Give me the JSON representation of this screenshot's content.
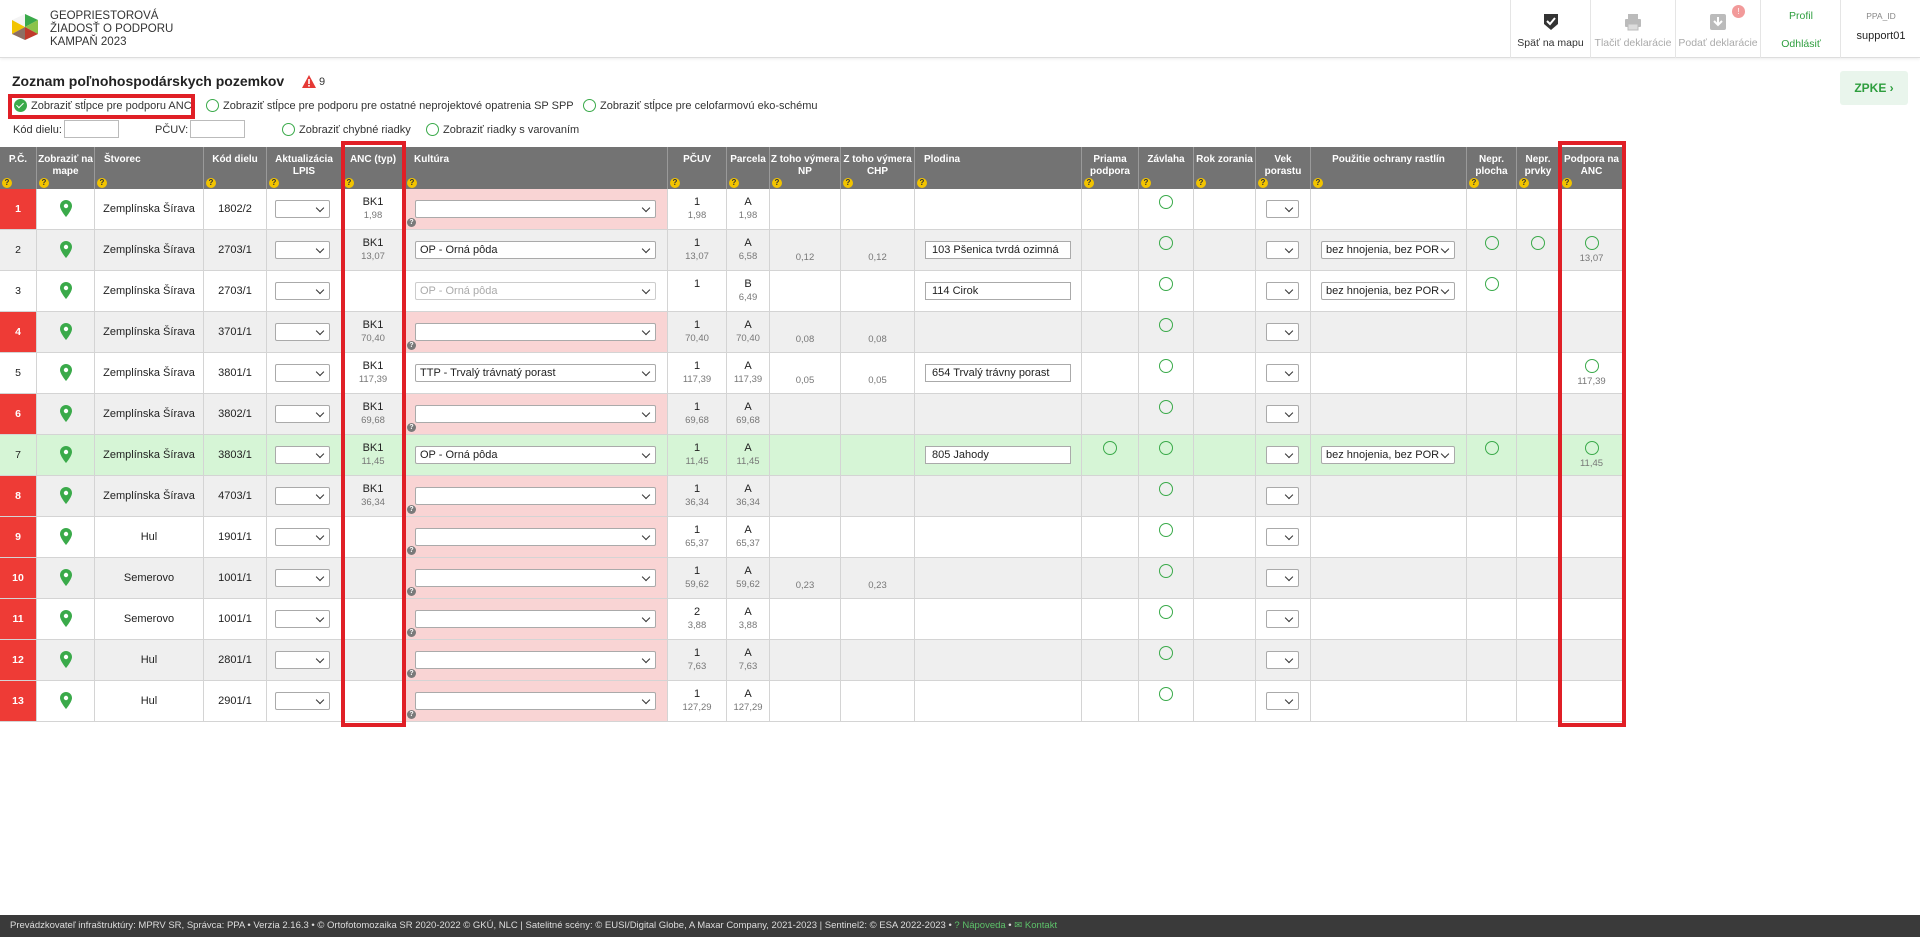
{
  "app": {
    "title_lines": [
      "GEOPRIESTOROVÁ",
      "ŽIADOSŤ O PODPORU",
      "KAMPAŇ 2023"
    ],
    "colors": {
      "accent": "#3aaa4a",
      "error": "#ee3b36",
      "highlight": "#e01f26",
      "header_bg": "#737373"
    }
  },
  "toolbar": {
    "back_to_map": "Späť na mapu",
    "print": "Tlačiť deklarácie",
    "submit": "Podať deklarácie",
    "submit_badge": "!",
    "profile": "Profil",
    "logout": "Odhlásiť",
    "ppa_id_label": "PPA_ID",
    "ppa_id_value": "support01"
  },
  "page": {
    "title": "Zoznam poľnohospodárskych pozemkov",
    "warning_count": "9",
    "zpke_label": "ZPKE"
  },
  "filters": {
    "anc": "Zobraziť stĺpce pre podporu ANC",
    "other": "Zobraziť stĺpce pre podporu pre ostatné neprojektové opatrenia SP SPP",
    "eco": "Zobraziť stĺpce pre celofarmovú eko-schému",
    "kod_dielu_label": "Kód dielu:",
    "pcuv_label": "PČUV:",
    "errors": "Zobraziť chybné riadky",
    "warnings": "Zobraziť riadky s varovaním"
  },
  "columns": {
    "pc": "P.Č.",
    "map": "Zobraziť na mape",
    "stvorec": "Štvorec",
    "kod": "Kód dielu",
    "lpis": "Aktualizácia LPIS",
    "anc": "ANC (typ)",
    "kultura": "Kultúra",
    "pcuv": "PČUV",
    "parcela": "Parcela",
    "np": "Z toho výmera NP",
    "chp": "Z toho výmera CHP",
    "plodina": "Plodina",
    "priama": "Priama podpora",
    "zavlaha": "Závlaha",
    "rok": "Rok zorania",
    "vek": "Vek porastu",
    "ochrana": "Použitie ochrany rastlín",
    "nepr_plocha": "Nepr. plocha",
    "nepr_prvky": "Nepr. prvky",
    "podpora_anc": "Podpora na ANC"
  },
  "rows": [
    {
      "pc": "1",
      "err": true,
      "stvorec": "Zemplínska Šírava",
      "kod": "1802/2",
      "anc": "BK1",
      "anc_area": "1,98",
      "kultura": "",
      "pcuv": "1",
      "pcuv_area": "1,98",
      "parcela": "A",
      "parcela_area": "1,98",
      "np": "",
      "chp": "",
      "plodina": "",
      "priama": false,
      "ochrana": "",
      "nepr_plocha": false,
      "nepr_prvky": false,
      "podpora": false,
      "podpora_area": ""
    },
    {
      "pc": "2",
      "err": false,
      "stvorec": "Zemplínska Šírava",
      "kod": "2703/1",
      "anc": "BK1",
      "anc_area": "13,07",
      "kultura": "OP - Orná pôda",
      "pcuv": "1",
      "pcuv_area": "13,07",
      "parcela": "A",
      "parcela_area": "6,58",
      "np": "0,12",
      "chp": "0,12",
      "plodina": "103  Pšenica tvrdá ozimná",
      "priama": false,
      "ochrana": "bez hnojenia, bez POR",
      "nepr_plocha": true,
      "nepr_prvky": true,
      "podpora": true,
      "podpora_area": "13,07"
    },
    {
      "pc": "3",
      "err": false,
      "stvorec": "Zemplínska Šírava",
      "kod": "2703/1",
      "anc": "",
      "anc_area": "",
      "kultura": "OP - Orná pôda",
      "kultura_disabled": true,
      "pcuv": "1",
      "pcuv_area": "",
      "parcela": "B",
      "parcela_area": "6,49",
      "np": "",
      "chp": "",
      "plodina": "114  Cirok",
      "priama": false,
      "ochrana": "bez hnojenia, bez POR",
      "nepr_plocha": true,
      "nepr_prvky": false,
      "podpora": false,
      "podpora_area": ""
    },
    {
      "pc": "4",
      "err": true,
      "stvorec": "Zemplínska Šírava",
      "kod": "3701/1",
      "anc": "BK1",
      "anc_area": "70,40",
      "kultura": "",
      "pcuv": "1",
      "pcuv_area": "70,40",
      "parcela": "A",
      "parcela_area": "70,40",
      "np": "0,08",
      "chp": "0,08",
      "plodina": "",
      "priama": false,
      "ochrana": "",
      "nepr_plocha": false,
      "nepr_prvky": false,
      "podpora": false,
      "podpora_area": ""
    },
    {
      "pc": "5",
      "err": false,
      "stvorec": "Zemplínska Šírava",
      "kod": "3801/1",
      "anc": "BK1",
      "anc_area": "117,39",
      "kultura": "TTP - Trvalý trávnatý porast",
      "pcuv": "1",
      "pcuv_area": "117,39",
      "parcela": "A",
      "parcela_area": "117,39",
      "np": "0,05",
      "chp": "0,05",
      "plodina": "654  Trvalý trávny porast",
      "priama": false,
      "ochrana": "",
      "nepr_plocha": false,
      "nepr_prvky": false,
      "podpora": true,
      "podpora_area": "117,39"
    },
    {
      "pc": "6",
      "err": true,
      "stvorec": "Zemplínska Šírava",
      "kod": "3802/1",
      "anc": "BK1",
      "anc_area": "69,68",
      "kultura": "",
      "pcuv": "1",
      "pcuv_area": "69,68",
      "parcela": "A",
      "parcela_area": "69,68",
      "np": "",
      "chp": "",
      "plodina": "",
      "priama": false,
      "ochrana": "",
      "nepr_plocha": false,
      "nepr_prvky": false,
      "podpora": false,
      "podpora_area": ""
    },
    {
      "pc": "7",
      "err": false,
      "green": true,
      "stvorec": "Zemplínska Šírava",
      "kod": "3803/1",
      "anc": "BK1",
      "anc_area": "11,45",
      "kultura": "OP - Orná pôda",
      "pcuv": "1",
      "pcuv_area": "11,45",
      "parcela": "A",
      "parcela_area": "11,45",
      "np": "",
      "chp": "",
      "plodina": "805  Jahody",
      "priama": true,
      "ochrana": "bez hnojenia, bez POR",
      "nepr_plocha": true,
      "nepr_prvky": false,
      "podpora": true,
      "podpora_area": "11,45"
    },
    {
      "pc": "8",
      "err": true,
      "stvorec": "Zemplínska Šírava",
      "kod": "4703/1",
      "anc": "BK1",
      "anc_area": "36,34",
      "kultura": "",
      "pcuv": "1",
      "pcuv_area": "36,34",
      "parcela": "A",
      "parcela_area": "36,34",
      "np": "",
      "chp": "",
      "plodina": "",
      "priama": false,
      "ochrana": "",
      "nepr_plocha": false,
      "nepr_prvky": false,
      "podpora": false,
      "podpora_area": ""
    },
    {
      "pc": "9",
      "err": true,
      "stvorec": "Hul",
      "kod": "1901/1",
      "anc": "",
      "anc_area": "",
      "kultura": "",
      "pcuv": "1",
      "pcuv_area": "65,37",
      "parcela": "A",
      "parcela_area": "65,37",
      "np": "",
      "chp": "",
      "plodina": "",
      "priama": false,
      "ochrana": "",
      "nepr_plocha": false,
      "nepr_prvky": false,
      "podpora": false,
      "podpora_area": ""
    },
    {
      "pc": "10",
      "err": true,
      "stvorec": "Semerovo",
      "kod": "1001/1",
      "anc": "",
      "anc_area": "",
      "kultura": "",
      "pcuv": "1",
      "pcuv_area": "59,62",
      "parcela": "A",
      "parcela_area": "59,62",
      "np": "0,23",
      "chp": "0,23",
      "plodina": "",
      "priama": false,
      "ochrana": "",
      "nepr_plocha": false,
      "nepr_prvky": false,
      "podpora": false,
      "podpora_area": ""
    },
    {
      "pc": "11",
      "err": true,
      "stvorec": "Semerovo",
      "kod": "1001/1",
      "anc": "",
      "anc_area": "",
      "kultura": "",
      "pcuv": "2",
      "pcuv_area": "3,88",
      "parcela": "A",
      "parcela_area": "3,88",
      "np": "",
      "chp": "",
      "plodina": "",
      "priama": false,
      "ochrana": "",
      "nepr_plocha": false,
      "nepr_prvky": false,
      "podpora": false,
      "podpora_area": ""
    },
    {
      "pc": "12",
      "err": true,
      "stvorec": "Hul",
      "kod": "2801/1",
      "anc": "",
      "anc_area": "",
      "kultura": "",
      "pcuv": "1",
      "pcuv_area": "7,63",
      "parcela": "A",
      "parcela_area": "7,63",
      "np": "",
      "chp": "",
      "plodina": "",
      "priama": false,
      "ochrana": "",
      "nepr_plocha": false,
      "nepr_prvky": false,
      "podpora": false,
      "podpora_area": ""
    },
    {
      "pc": "13",
      "err": true,
      "stvorec": "Hul",
      "kod": "2901/1",
      "anc": "",
      "anc_area": "",
      "kultura": "",
      "pcuv": "1",
      "pcuv_area": "127,29",
      "parcela": "A",
      "parcela_area": "127,29",
      "np": "",
      "chp": "",
      "plodina": "",
      "priama": false,
      "ochrana": "",
      "nepr_plocha": false,
      "nepr_prvky": false,
      "podpora": false,
      "podpora_area": ""
    }
  ],
  "footer": {
    "text": "Prevádzkovateľ infraštruktúry: MPRV SR, Správca: PPA • Verzia 2.16.3 • © Ortofotomozaika SR 2020-2022 © GKÚ, NLC | Satelitné scény: © EUSI/Digital Globe, A Maxar Company, 2021-2023 | Sentinel2: © ESA 2022-2023 •",
    "help": "Nápoveda",
    "contact": "Kontakt"
  }
}
